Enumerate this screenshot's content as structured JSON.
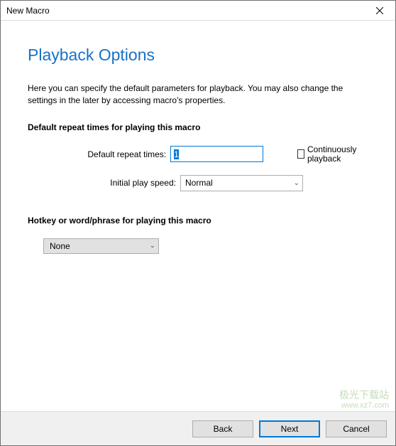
{
  "window": {
    "title": "New Macro"
  },
  "page": {
    "heading": "Playback Options",
    "description": "Here you can specify the default parameters for playback. You may also change the settings in the later by accessing macro's properties."
  },
  "section_repeat": {
    "title": "Default repeat times for playing this macro",
    "repeat_label": "Default repeat times:",
    "repeat_value": "1",
    "continuous_label": "Continuously playback",
    "speed_label": "Initial play speed:",
    "speed_value": "Normal"
  },
  "section_hotkey": {
    "title": "Hotkey or word/phrase for playing this macro",
    "value": "None"
  },
  "buttons": {
    "back": "Back",
    "next": "Next",
    "cancel": "Cancel"
  },
  "watermark": {
    "line1": "极光下载站",
    "line2": "www.xz7.com"
  }
}
